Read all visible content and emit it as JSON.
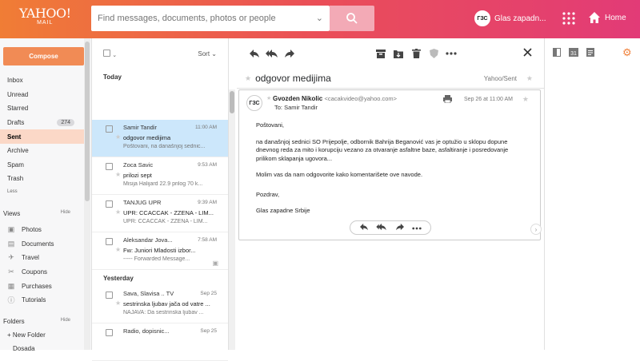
{
  "header": {
    "logo_top": "YAHOO!",
    "logo_bottom": "MAIL",
    "search_placeholder": "Find messages, documents, photos or people",
    "profile_name": "Glas zapadn...",
    "avatar_text": "ГЗС",
    "home_label": "Home"
  },
  "sidebar": {
    "compose_label": "Compose",
    "folders": [
      {
        "label": "Inbox"
      },
      {
        "label": "Unread"
      },
      {
        "label": "Starred"
      },
      {
        "label": "Drafts",
        "count": "274"
      },
      {
        "label": "Sent",
        "active": true
      },
      {
        "label": "Archive"
      },
      {
        "label": "Spam"
      },
      {
        "label": "Trash"
      }
    ],
    "less_label": "Less",
    "views_title": "Views",
    "views_hide": "Hide",
    "views": [
      {
        "label": "Photos",
        "icon": "photo-icon"
      },
      {
        "label": "Documents",
        "icon": "document-icon"
      },
      {
        "label": "Travel",
        "icon": "plane-icon"
      },
      {
        "label": "Coupons",
        "icon": "scissors-icon"
      },
      {
        "label": "Purchases",
        "icon": "bag-icon"
      },
      {
        "label": "Tutorials",
        "icon": "info-icon"
      }
    ],
    "folders_title": "Folders",
    "folders_hide": "Hide",
    "new_folder_label": "+ New Folder",
    "extra_folder": "Dosada"
  },
  "list": {
    "sort_label": "Sort",
    "groups": [
      {
        "day": "Today"
      },
      {
        "day": "Yesterday"
      }
    ],
    "messages_today": [
      {
        "from": "Samir Tandir",
        "time": "11:00 AM",
        "subject": "odgovor medijima",
        "snippet": "Poštovani, na današnjoj sednic...",
        "selected": true
      },
      {
        "from": "Zoca Savic",
        "time": "9:53 AM",
        "subject": "prilozi sept",
        "snippet": "Misija Halijard 22.9 prilog 70 k..."
      },
      {
        "from": "TANJUG UPR",
        "time": "9:39 AM",
        "subject": "UPR: CCACCAK - ZZENA - LIM...",
        "snippet": "UPR: CCACCAK - ZZENA - LIM..."
      },
      {
        "from": "Aleksandar Jova...",
        "time": "7:58 AM",
        "subject": "Fw: Juniori Mladosti izbor...",
        "snippet": "----- Forwarded Message..."
      }
    ],
    "messages_yesterday": [
      {
        "from": "Sava, Slavisa .. TV",
        "time": "Sep 25",
        "subject": "sestrinska ljubav jača od vatre ...",
        "snippet": "NAJAVA: Da sestrinska ljubav ..."
      },
      {
        "from": "Radio, dopisnic...",
        "time": "Sep 25",
        "subject": "",
        "snippet": ""
      }
    ]
  },
  "reader": {
    "subject": "odgovor medijima",
    "folder": "Yahoo/Sent",
    "sender_name": "Gvozden Nikolic",
    "sender_email": "<cacakvideo@yahoo.com>",
    "to": "To: Samir Tandir",
    "date": "Sep 26 at 11:00 AM",
    "body": [
      "Poštovani,",
      "na današnjoj sednici SO Prijepolje, odbornik Bahrija Beganović vas je optužio u sklopu dopune dnevnog reda za mito i korupciju vezano za otvaranje asfaltne baze, asfaltiranje i posredovanje prilikom sklapanja ugovora...",
      "Molim vas da nam odgovorite kako komentarišete ove navode.",
      "Pozdrav,",
      "Glas zapadne Srbije"
    ]
  },
  "colors": {
    "accent": "#f18b55",
    "selected_row": "#cce7fb",
    "active_folder": "#fbd8c7"
  }
}
